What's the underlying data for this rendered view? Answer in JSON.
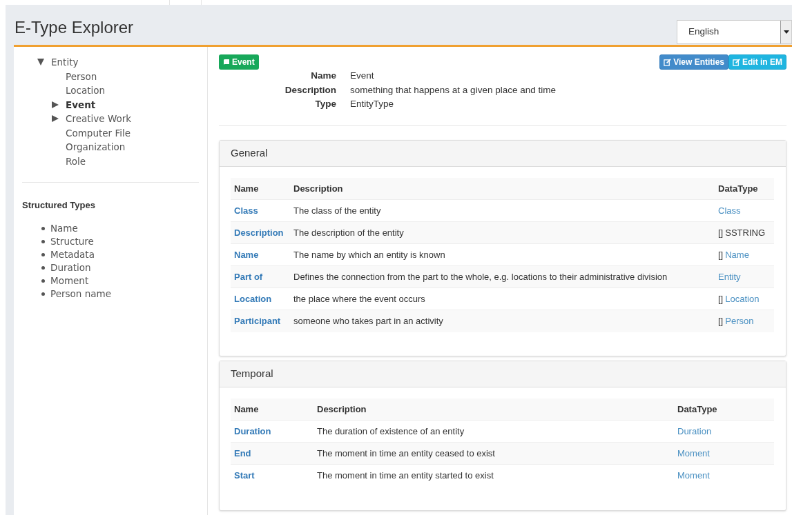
{
  "header": {
    "title": "E-Type Explorer",
    "language": "English"
  },
  "tree": [
    {
      "label": "Entity",
      "kind": "branch",
      "expanded": true,
      "selected": false,
      "children": [
        {
          "label": "Person",
          "kind": "leaf",
          "selected": false
        },
        {
          "label": "Location",
          "kind": "leaf",
          "selected": false
        },
        {
          "label": "Event",
          "kind": "branch",
          "expanded": false,
          "selected": true
        },
        {
          "label": "Creative Work",
          "kind": "branch",
          "expanded": false,
          "selected": false
        },
        {
          "label": "Computer File",
          "kind": "leaf",
          "selected": false
        },
        {
          "label": "Organization",
          "kind": "leaf",
          "selected": false
        },
        {
          "label": "Role",
          "kind": "leaf",
          "selected": false
        }
      ]
    }
  ],
  "structured_types": {
    "title": "Structured Types",
    "items": [
      "Name",
      "Structure",
      "Metadata",
      "Duration",
      "Moment",
      "Person name"
    ]
  },
  "entity": {
    "badge": "Event",
    "buttons": [
      {
        "label": "View Entities",
        "kind": "primary"
      },
      {
        "label": "Edit in EM",
        "kind": "info"
      }
    ],
    "fields": [
      {
        "label": "Name",
        "value": "Event"
      },
      {
        "label": "Description",
        "value": "something that happens at a given place and time"
      },
      {
        "label": "Type",
        "value": "EntityType"
      }
    ]
  },
  "sections": [
    {
      "title": "General",
      "columns": [
        "Name",
        "Description",
        "DataType"
      ],
      "rows": [
        {
          "name": "Class",
          "description": "The class of the entity",
          "datatype": {
            "label": "Class",
            "kind": "link"
          }
        },
        {
          "name": "Description",
          "description": "The description of the entity",
          "datatype": {
            "prefix": "[]",
            "label": "SSTRING",
            "kind": "plain"
          }
        },
        {
          "name": "Name",
          "description": "The name by which an entity is known",
          "datatype": {
            "prefix": "[]",
            "label": "Name",
            "kind": "link"
          }
        },
        {
          "name": "Part of",
          "description": "Defines the connection from the part to the whole, e.g. locations to their administrative division",
          "datatype": {
            "label": "Entity",
            "kind": "link"
          }
        },
        {
          "name": "Location",
          "description": "the place where the event occurs",
          "datatype": {
            "prefix": "[]",
            "label": "Location",
            "kind": "link"
          }
        },
        {
          "name": "Participant",
          "description": "someone who takes part in an activity",
          "datatype": {
            "prefix": "[]",
            "label": "Person",
            "kind": "link"
          }
        }
      ]
    },
    {
      "title": "Temporal",
      "columns": [
        "Name",
        "Description",
        "DataType"
      ],
      "rows": [
        {
          "name": "Duration",
          "description": "The duration of existence of an entity",
          "datatype": {
            "label": "Duration",
            "kind": "link"
          }
        },
        {
          "name": "End",
          "description": "The moment in time an entity ceased to exist",
          "datatype": {
            "label": "Moment",
            "kind": "link"
          }
        },
        {
          "name": "Start",
          "description": "The moment in time an entity started to exist",
          "datatype": {
            "label": "Moment",
            "kind": "link"
          }
        }
      ]
    }
  ]
}
